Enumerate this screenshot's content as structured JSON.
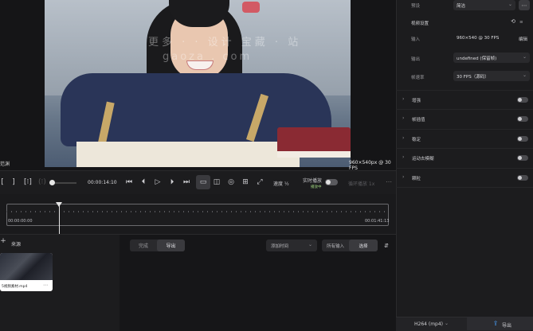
{
  "viewer": {
    "left_label": "范渊",
    "resolution_overlay": "960×540px @ 30 FPS",
    "watermark_line1": "更多 ·  · 设计 宝藏 · 站",
    "watermark_line2": "gaoza . com"
  },
  "transport": {
    "timecode": "00:00:14:10",
    "speed": "速度 ½",
    "realtime_label": "实时播放",
    "realtime_sub": "播放中",
    "realtime_on": false,
    "dim_label": "循环播放 1x"
  },
  "timeline": {
    "start_time": "00:00:00:00",
    "end_time": "00:01:41:13"
  },
  "bin": {
    "title": "来源",
    "clip_name": "5视频素材.mp4"
  },
  "queue": {
    "tab_done": "完成",
    "tab_export": "导出",
    "sort_label": "添加时间",
    "import_all": "所有输入",
    "select_button": "选择"
  },
  "inspector": {
    "preset_label": "预设",
    "preset_value": "简洁",
    "video_settings_title": "视频设置",
    "input_label": "输入",
    "input_value": "960×540 @ 30 FPS",
    "edit_label": "编辑",
    "output_label": "输出",
    "output_value": "undefined (保留帧)",
    "framerate_label": "帧速率",
    "framerate_value": "30 FPS（源码）",
    "sections": [
      {
        "name": "增强",
        "on": false
      },
      {
        "name": "帧插值",
        "on": false
      },
      {
        "name": "稳定",
        "on": false
      },
      {
        "name": "运动去模糊",
        "on": false
      },
      {
        "name": "颗粒",
        "on": false
      }
    ]
  },
  "bottombar": {
    "format": "H264 (mp4)",
    "export_label": "导出"
  }
}
